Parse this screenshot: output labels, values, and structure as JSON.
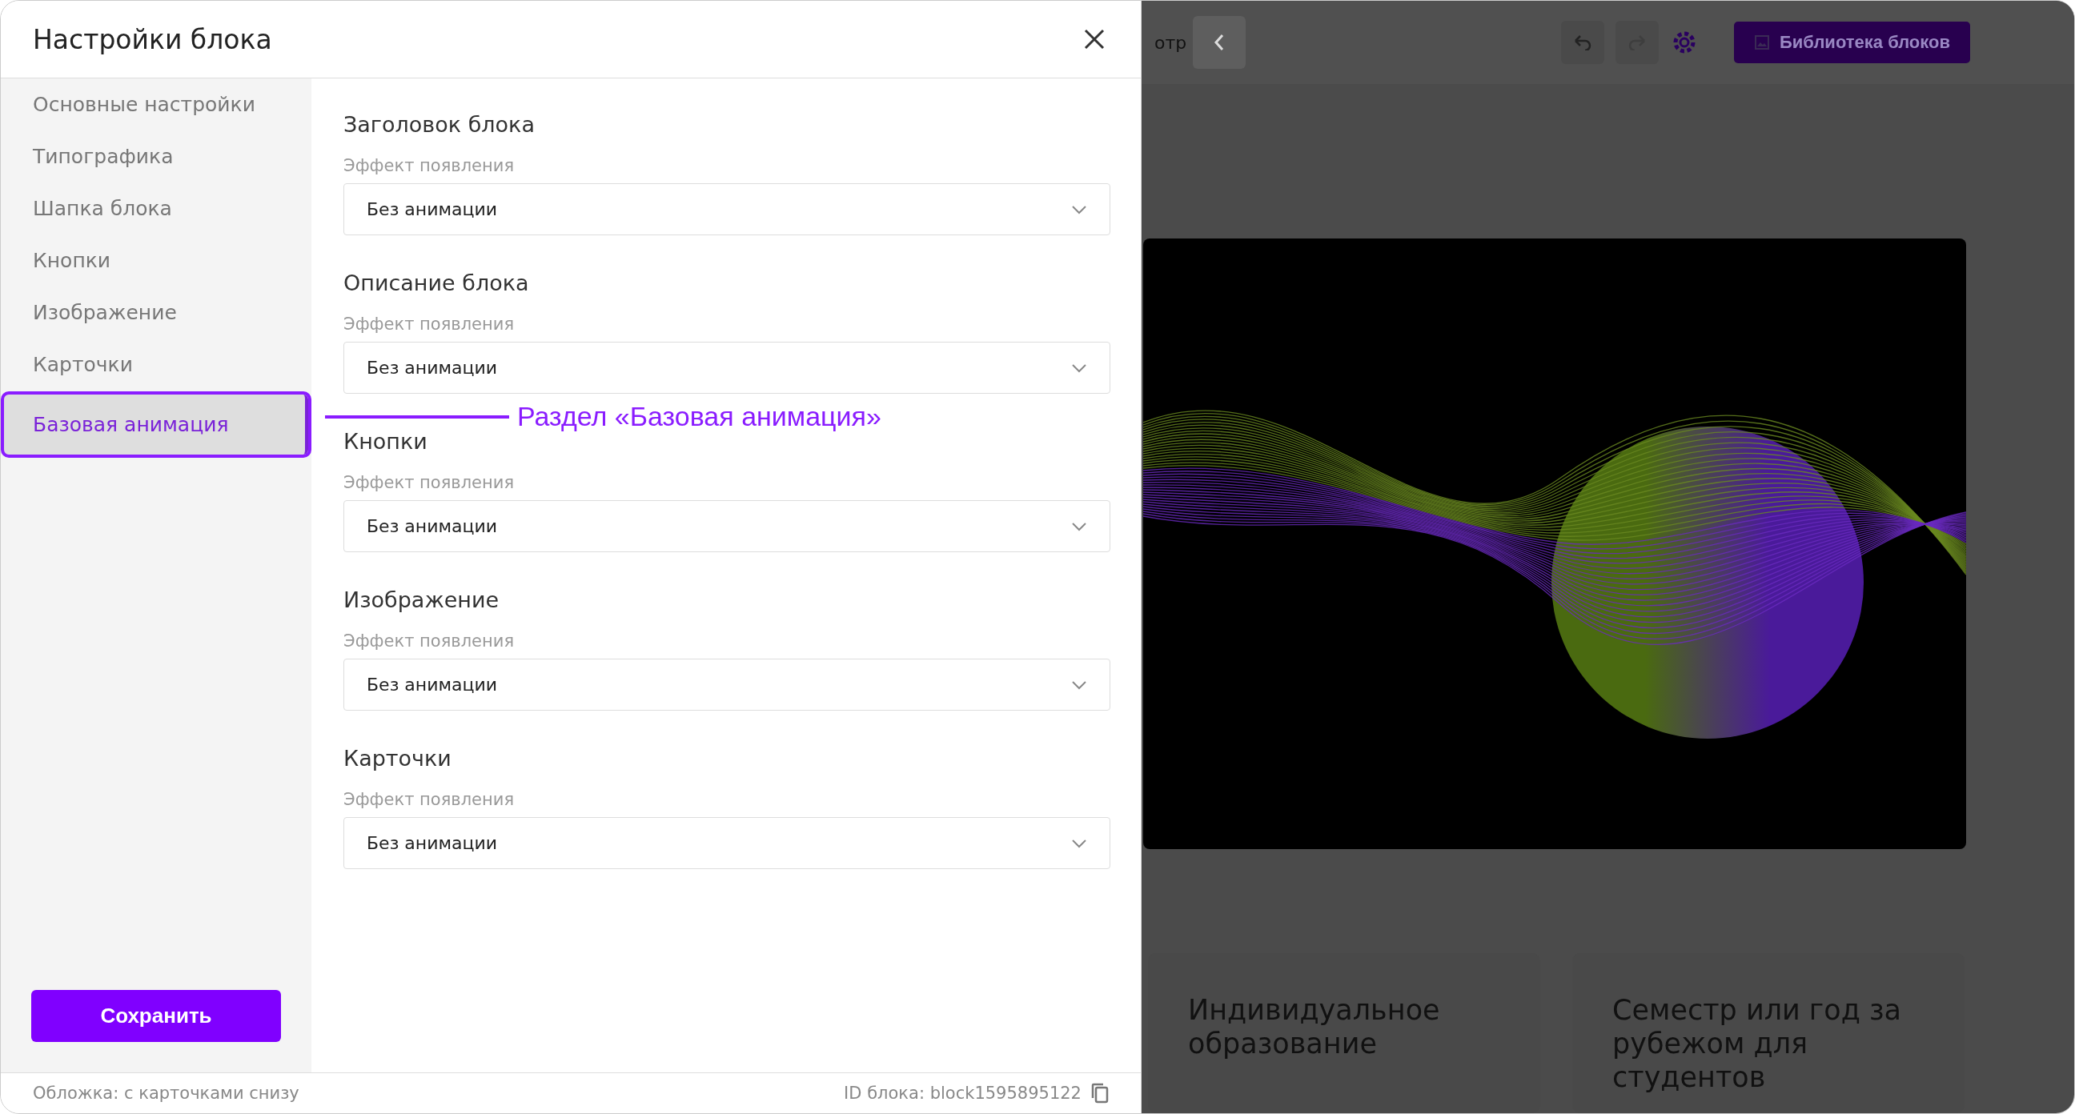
{
  "modal": {
    "title": "Настройки блока",
    "sidebar": {
      "items": [
        {
          "label": "Основные настройки",
          "selected": false
        },
        {
          "label": "Типографика",
          "selected": false
        },
        {
          "label": "Шапка блока",
          "selected": false
        },
        {
          "label": "Кнопки",
          "selected": false
        },
        {
          "label": "Изображение",
          "selected": false
        },
        {
          "label": "Карточки",
          "selected": false
        },
        {
          "label": "Базовая анимация",
          "selected": true
        }
      ]
    },
    "sections": [
      {
        "heading": "Заголовок блока",
        "field_label": "Эффект появления",
        "value": "Без анимации"
      },
      {
        "heading": "Описание блока",
        "field_label": "Эффект появления",
        "value": "Без анимации"
      },
      {
        "heading": "Кнопки",
        "field_label": "Эффект появления",
        "value": "Без анимации"
      },
      {
        "heading": "Изображение",
        "field_label": "Эффект появления",
        "value": "Без анимации"
      },
      {
        "heading": "Карточки",
        "field_label": "Эффект появления",
        "value": "Без анимации"
      }
    ],
    "save_button": "Сохранить",
    "footer": {
      "left": "Обложка: с карточками снизу",
      "right": "ID блока: block1595895122"
    }
  },
  "annotation": {
    "text": "Раздел «Базовая анимация»"
  },
  "page": {
    "partial_text": "отр",
    "library_button": "Библиотека блоков",
    "cards": [
      {
        "title": "Индивидуальное образование"
      },
      {
        "title": "Семестр или год за рубежом для студентов"
      }
    ]
  }
}
